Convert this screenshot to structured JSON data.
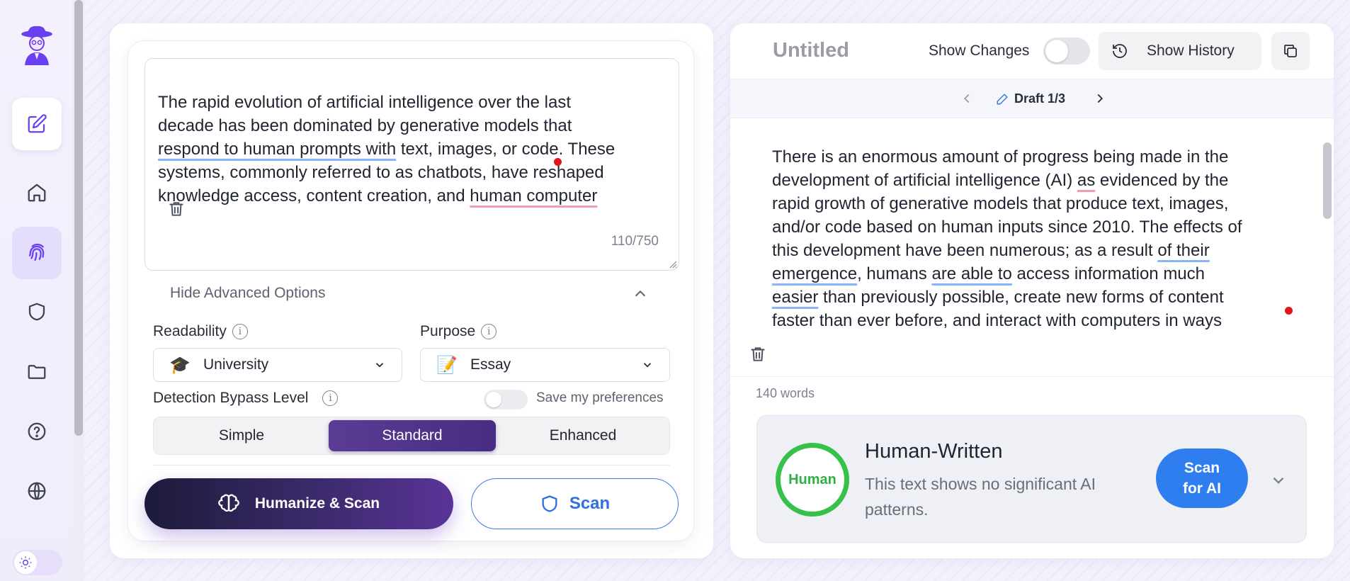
{
  "sidebar": {
    "logo": "fedora-man-logo",
    "items": [
      {
        "name": "edit",
        "icon": "edit-icon",
        "state": "active-white"
      },
      {
        "name": "home",
        "icon": "home-icon",
        "state": "default"
      },
      {
        "name": "fingerprint",
        "icon": "fingerprint-icon",
        "state": "active-lavender"
      },
      {
        "name": "shield",
        "icon": "shield-icon",
        "state": "default"
      },
      {
        "name": "folder",
        "icon": "folder-icon",
        "state": "default"
      },
      {
        "name": "help",
        "icon": "help-icon",
        "state": "default"
      },
      {
        "name": "globe",
        "icon": "globe-icon",
        "state": "default"
      }
    ],
    "theme_toggle_icon": "sun-icon"
  },
  "input": {
    "line1": "The rapid evolution of artificial intelligence over the last",
    "line2": "decade has been dominated by generative models that",
    "line3_underlined": "respond to human prompts with",
    "line3_rest": " text, images, or code. These",
    "line4": "systems, commonly referred to as chatbots, have reshaped",
    "line5_start": "knowledge access, content creation, and ",
    "line5_underlined": "human computer",
    "char_count": "110/750"
  },
  "advanced": {
    "toggle_label": "Hide Advanced Options",
    "readability_label": "Readability",
    "readability_value": "University",
    "readability_emoji": "🎓",
    "purpose_label": "Purpose",
    "purpose_value": "Essay",
    "purpose_emoji": "📝",
    "bypass_label": "Detection Bypass Level",
    "save_pref_label": "Save my preferences",
    "levels": [
      "Simple",
      "Standard",
      "Enhanced"
    ],
    "selected_level": "Standard"
  },
  "actions": {
    "humanize_label": "Humanize & Scan",
    "scan_label": "Scan"
  },
  "output": {
    "title": "Untitled",
    "show_changes_label": "Show Changes",
    "show_history_label": "Show History",
    "draft_label": "Draft 1/3",
    "p1": "There is an enormous amount of progress being made in the",
    "p2a": "development of artificial intelligence (AI) ",
    "p2u": "as",
    "p2b": " evidenced by the",
    "p3": "rapid growth of generative models that produce text, images,",
    "p4": "and/or code based on human inputs since 2010. The effects of",
    "p5a": "this development have been numerous; as a result ",
    "p5u": "of their",
    "p6u": "emergence",
    "p6a": ", humans ",
    "p6u2": "are able to",
    "p6b": " access information much",
    "p7u": "easier",
    "p7a": " than previously possible, create new forms of content",
    "p8": "faster than ever before, and interact with computers in ways",
    "word_count": "140 words"
  },
  "result": {
    "badge": "Human",
    "title": "Human-Written",
    "description": "This text shows no significant AI patterns.",
    "scan_ai_line1": "Scan",
    "scan_ai_line2": "for AI"
  },
  "colors": {
    "accent_purple": "#6a3ff0",
    "scan_blue": "#2f7ef0",
    "human_green": "#35c14a",
    "underline_blue": "#8ab4f8",
    "underline_pink": "#f49ab5"
  }
}
